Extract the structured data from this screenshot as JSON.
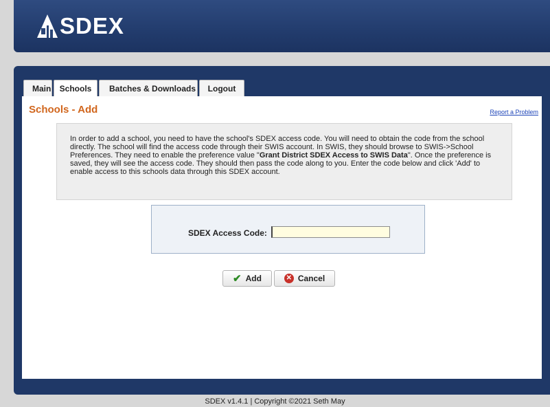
{
  "header": {
    "logo_text": "SDEX"
  },
  "tabs": [
    {
      "label": "Main"
    },
    {
      "label": "Schools"
    },
    {
      "label": "Batches & Downloads"
    },
    {
      "label": "Logout"
    }
  ],
  "page": {
    "title": "Schools - Add",
    "report_link": "Report a Problem"
  },
  "info": {
    "text_before": "In order to add a school, you need to have the school's SDEX access code. You will need to obtain the code from the school directly. The school will find the access code through their SWIS account. In SWIS, they should browse to SWIS->School Preferences. They need to enable the preference value \"",
    "text_bold": "Grant District SDEX Access to SWIS Data",
    "text_after": "\". Once the preference is saved, they will see the access code. They should then pass the code along to you. Enter the code below and click 'Add' to enable access to this schools data through this SDEX account."
  },
  "form": {
    "code_label": "SDEX Access Code:",
    "code_value": ""
  },
  "buttons": {
    "add_label": "Add",
    "cancel_label": "Cancel"
  },
  "footer": {
    "text": "SDEX v1.4.1 | Copyright ©2021 Seth May"
  }
}
